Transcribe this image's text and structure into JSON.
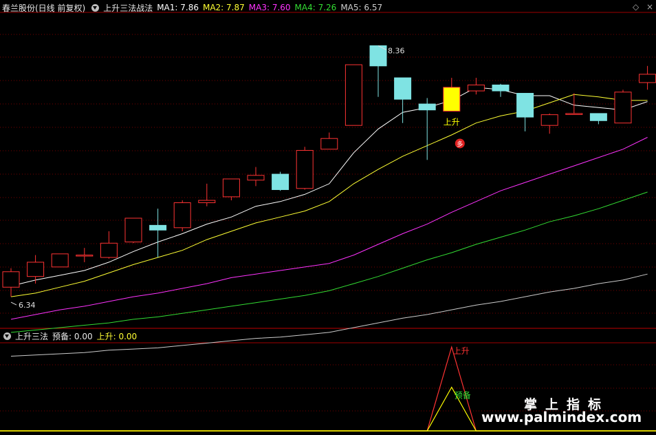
{
  "header": {
    "stock": "春兰股份(日线 前复权)",
    "indicator": "上升三法战法",
    "ma": [
      {
        "label": "MA1: 7.86",
        "color": "#ffffff"
      },
      {
        "label": "MA2: 7.87",
        "color": "#ffff33"
      },
      {
        "label": "MA3: 7.60",
        "color": "#ff33ff"
      },
      {
        "label": "MA4: 7.26",
        "color": "#33dd33"
      },
      {
        "label": "MA5: 6.57",
        "color": "#cccccc"
      }
    ]
  },
  "sub_header": {
    "name": "上升三法",
    "ready": "预备: 0.00",
    "rise": "上升: 0.00"
  },
  "watermark": {
    "brand": "掌上指标",
    "url": "www.palmindex.com"
  },
  "colors": {
    "up": "#ff3333",
    "down": "#7fe3e3",
    "signal": "#ffff00",
    "grid": "#7a0000"
  },
  "chart_data": {
    "type": "candlestick",
    "ylim": [
      6.0,
      8.65
    ],
    "high_label": "8.36",
    "low_label": "6.34",
    "candles": [
      {
        "o": 6.34,
        "c": 6.47,
        "h": 6.5,
        "l": 6.26
      },
      {
        "o": 6.43,
        "c": 6.55,
        "h": 6.61,
        "l": 6.37
      },
      {
        "o": 6.51,
        "c": 6.62,
        "h": 6.62,
        "l": 6.51
      },
      {
        "o": 6.61,
        "c": 6.61,
        "h": 6.67,
        "l": 6.55
      },
      {
        "o": 6.59,
        "c": 6.71,
        "h": 6.81,
        "l": 6.58
      },
      {
        "o": 6.72,
        "c": 6.92,
        "h": 6.92,
        "l": 6.71
      },
      {
        "o": 6.86,
        "c": 6.82,
        "h": 7.0,
        "l": 6.59
      },
      {
        "o": 6.84,
        "c": 7.05,
        "h": 7.07,
        "l": 6.81
      },
      {
        "o": 7.05,
        "c": 7.07,
        "h": 7.21,
        "l": 7.02
      },
      {
        "o": 7.1,
        "c": 7.25,
        "h": 7.25,
        "l": 7.07
      },
      {
        "o": 7.24,
        "c": 7.28,
        "h": 7.35,
        "l": 7.19
      },
      {
        "o": 7.29,
        "c": 7.16,
        "h": 7.31,
        "l": 7.15
      },
      {
        "o": 7.17,
        "c": 7.49,
        "h": 7.52,
        "l": 7.16
      },
      {
        "o": 7.5,
        "c": 7.59,
        "h": 7.64,
        "l": 7.5
      },
      {
        "o": 7.7,
        "c": 8.21,
        "h": 8.21,
        "l": 7.7
      },
      {
        "o": 8.37,
        "c": 8.2,
        "h": 8.37,
        "l": 7.94
      },
      {
        "o": 8.1,
        "c": 7.92,
        "h": 8.1,
        "l": 7.72
      },
      {
        "o": 7.88,
        "c": 7.83,
        "h": 7.93,
        "l": 7.41
      },
      {
        "o": 7.82,
        "c": 8.02,
        "h": 8.1,
        "l": 7.82
      },
      {
        "o": 7.99,
        "c": 8.04,
        "h": 8.1,
        "l": 7.96
      },
      {
        "o": 8.04,
        "c": 7.99,
        "h": 8.05,
        "l": 7.94
      },
      {
        "o": 7.97,
        "c": 7.77,
        "h": 7.97,
        "l": 7.65
      },
      {
        "o": 7.7,
        "c": 7.79,
        "h": 7.8,
        "l": 7.63
      },
      {
        "o": 7.8,
        "c": 7.8,
        "h": 7.97,
        "l": 7.79
      },
      {
        "o": 7.8,
        "c": 7.74,
        "h": 7.8,
        "l": 7.71
      },
      {
        "o": 7.72,
        "c": 7.98,
        "h": 8.0,
        "l": 7.72
      },
      {
        "o": 8.06,
        "c": 8.13,
        "h": 8.2,
        "l": 8.0
      }
    ],
    "highlight_index": 18,
    "signal_label": "上升",
    "marker_label": "多",
    "series": [
      {
        "name": "MA1",
        "color": "#ffffff",
        "values": [
          6.35,
          6.4,
          6.44,
          6.48,
          6.55,
          6.64,
          6.72,
          6.79,
          6.87,
          6.93,
          7.02,
          7.06,
          7.12,
          7.21,
          7.47,
          7.67,
          7.81,
          7.85,
          7.91,
          8.02,
          8.0,
          7.95,
          7.95,
          7.87,
          7.85,
          7.83,
          7.9
        ]
      },
      {
        "name": "MA2",
        "color": "#ffff33",
        "values": [
          6.26,
          6.29,
          6.34,
          6.39,
          6.46,
          6.53,
          6.59,
          6.65,
          6.74,
          6.81,
          6.88,
          6.93,
          6.98,
          7.06,
          7.21,
          7.33,
          7.44,
          7.53,
          7.62,
          7.72,
          7.78,
          7.82,
          7.89,
          7.96,
          7.94,
          7.91,
          7.91
        ]
      },
      {
        "name": "MA3",
        "color": "#ff33ff",
        "values": [
          6.07,
          6.11,
          6.15,
          6.18,
          6.22,
          6.26,
          6.29,
          6.33,
          6.37,
          6.42,
          6.45,
          6.48,
          6.51,
          6.54,
          6.61,
          6.7,
          6.79,
          6.87,
          6.97,
          7.06,
          7.15,
          7.22,
          7.29,
          7.36,
          7.43,
          7.5,
          7.6
        ]
      },
      {
        "name": "MA4",
        "color": "#33dd33",
        "values": [
          5.96,
          5.98,
          6.0,
          6.02,
          6.04,
          6.07,
          6.09,
          6.12,
          6.15,
          6.18,
          6.21,
          6.24,
          6.27,
          6.31,
          6.37,
          6.43,
          6.5,
          6.57,
          6.63,
          6.7,
          6.76,
          6.82,
          6.89,
          6.94,
          7.0,
          7.07,
          7.14
        ]
      },
      {
        "name": "MA5",
        "color": "#cccccc",
        "values": [
          5.76,
          5.77,
          5.78,
          5.79,
          5.81,
          5.82,
          5.83,
          5.85,
          5.87,
          5.89,
          5.91,
          5.92,
          5.94,
          5.96,
          6.0,
          6.04,
          6.08,
          6.11,
          6.15,
          6.19,
          6.22,
          6.26,
          6.3,
          6.33,
          6.37,
          6.4,
          6.45
        ]
      }
    ],
    "sub": {
      "ylim": [
        0,
        1.05
      ],
      "ready": {
        "name": "预备",
        "color": "#ffff00",
        "peak_index": 18,
        "peak": 0.52
      },
      "rise": {
        "name": "上升",
        "color": "#ff3333",
        "peak_index": 18,
        "peak": 1.0
      }
    }
  }
}
